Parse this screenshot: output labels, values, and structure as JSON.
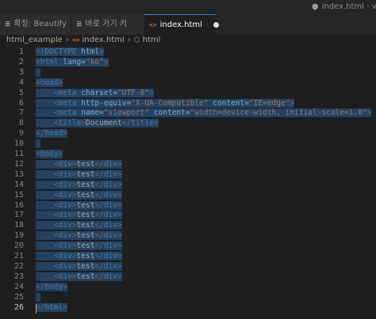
{
  "window": {
    "title": "index.html - vs"
  },
  "tabs": [
    {
      "label": "확장: Beautify",
      "icon": "extension-list-icon",
      "active": false
    },
    {
      "label": "바로 가기 키",
      "icon": "keyboard-list-icon",
      "active": false
    },
    {
      "label": "index.html",
      "icon": "html-file-icon",
      "active": true,
      "modified": true
    }
  ],
  "breadcrumb": {
    "folder": "html_example",
    "file": "index.html",
    "element": "html"
  },
  "editor": {
    "current_line": 26,
    "lines": [
      {
        "n": "1",
        "indent": 0,
        "parts": [
          [
            "pu",
            "<"
          ],
          [
            "tg",
            "!DOCTYPE"
          ],
          [
            "tx",
            " "
          ],
          [
            "at",
            "html"
          ],
          [
            "pu",
            ">"
          ]
        ]
      },
      {
        "n": "2",
        "indent": 0,
        "parts": [
          [
            "pu",
            "<"
          ],
          [
            "tg",
            "html"
          ],
          [
            "tx",
            " "
          ],
          [
            "at",
            "lang"
          ],
          [
            "tx",
            "="
          ],
          [
            "av",
            "\"ko\""
          ],
          [
            "pu",
            ">"
          ]
        ]
      },
      {
        "n": "3",
        "indent": 0,
        "parts": []
      },
      {
        "n": "4",
        "indent": 0,
        "parts": [
          [
            "pu",
            "<"
          ],
          [
            "tg",
            "head"
          ],
          [
            "pu",
            ">"
          ]
        ]
      },
      {
        "n": "5",
        "indent": 1,
        "parts": [
          [
            "pu",
            "<"
          ],
          [
            "tg",
            "meta"
          ],
          [
            "tx",
            " "
          ],
          [
            "at",
            "charset"
          ],
          [
            "tx",
            "="
          ],
          [
            "av",
            "\"UTF-8\""
          ],
          [
            "pu",
            ">"
          ]
        ]
      },
      {
        "n": "6",
        "indent": 1,
        "parts": [
          [
            "pu",
            "<"
          ],
          [
            "tg",
            "meta"
          ],
          [
            "tx",
            " "
          ],
          [
            "at",
            "http-equiv"
          ],
          [
            "tx",
            "="
          ],
          [
            "av",
            "\"X-UA-Compatible\""
          ],
          [
            "tx",
            " "
          ],
          [
            "at",
            "content"
          ],
          [
            "tx",
            "="
          ],
          [
            "av",
            "\"IE=edge\""
          ],
          [
            "pu",
            ">"
          ]
        ]
      },
      {
        "n": "7",
        "indent": 1,
        "parts": [
          [
            "pu",
            "<"
          ],
          [
            "tg",
            "meta"
          ],
          [
            "tx",
            " "
          ],
          [
            "at",
            "name"
          ],
          [
            "tx",
            "="
          ],
          [
            "av",
            "\"viewport\""
          ],
          [
            "tx",
            " "
          ],
          [
            "at",
            "content"
          ],
          [
            "tx",
            "="
          ],
          [
            "av",
            "\"width=device-width, initial-scale=1.0\""
          ],
          [
            "pu",
            ">"
          ]
        ]
      },
      {
        "n": "8",
        "indent": 1,
        "parts": [
          [
            "pu",
            "<"
          ],
          [
            "tg",
            "title"
          ],
          [
            "pu",
            ">"
          ],
          [
            "tx",
            "Document"
          ],
          [
            "pu",
            "</"
          ],
          [
            "tg",
            "title"
          ],
          [
            "pu",
            ">"
          ]
        ]
      },
      {
        "n": "9",
        "indent": 0,
        "parts": [
          [
            "pu",
            "</"
          ],
          [
            "tg",
            "head"
          ],
          [
            "pu",
            ">"
          ]
        ]
      },
      {
        "n": "10",
        "indent": 0,
        "parts": []
      },
      {
        "n": "11",
        "indent": 0,
        "parts": [
          [
            "pu",
            "<"
          ],
          [
            "tg",
            "body"
          ],
          [
            "pu",
            ">"
          ]
        ]
      },
      {
        "n": "12",
        "indent": 1,
        "parts": [
          [
            "pu",
            "<"
          ],
          [
            "tg",
            "div"
          ],
          [
            "pu",
            ">"
          ],
          [
            "tx",
            "test"
          ],
          [
            "pu",
            "</"
          ],
          [
            "tg",
            "div"
          ],
          [
            "pu",
            ">"
          ]
        ]
      },
      {
        "n": "13",
        "indent": 1,
        "parts": [
          [
            "pu",
            "<"
          ],
          [
            "tg",
            "div"
          ],
          [
            "pu",
            ">"
          ],
          [
            "tx",
            "test"
          ],
          [
            "pu",
            "</"
          ],
          [
            "tg",
            "div"
          ],
          [
            "pu",
            ">"
          ]
        ]
      },
      {
        "n": "14",
        "indent": 1,
        "parts": [
          [
            "pu",
            "<"
          ],
          [
            "tg",
            "div"
          ],
          [
            "pu",
            ">"
          ],
          [
            "tx",
            "test"
          ],
          [
            "pu",
            "</"
          ],
          [
            "tg",
            "div"
          ],
          [
            "pu",
            ">"
          ]
        ]
      },
      {
        "n": "15",
        "indent": 1,
        "parts": [
          [
            "pu",
            "<"
          ],
          [
            "tg",
            "div"
          ],
          [
            "pu",
            ">"
          ],
          [
            "tx",
            "test"
          ],
          [
            "pu",
            "</"
          ],
          [
            "tg",
            "div"
          ],
          [
            "pu",
            ">"
          ]
        ]
      },
      {
        "n": "16",
        "indent": 1,
        "parts": [
          [
            "pu",
            "<"
          ],
          [
            "tg",
            "div"
          ],
          [
            "pu",
            ">"
          ],
          [
            "tx",
            "test"
          ],
          [
            "pu",
            "</"
          ],
          [
            "tg",
            "div"
          ],
          [
            "pu",
            ">"
          ]
        ]
      },
      {
        "n": "17",
        "indent": 1,
        "parts": [
          [
            "pu",
            "<"
          ],
          [
            "tg",
            "div"
          ],
          [
            "pu",
            ">"
          ],
          [
            "tx",
            "test"
          ],
          [
            "pu",
            "</"
          ],
          [
            "tg",
            "div"
          ],
          [
            "pu",
            ">"
          ]
        ]
      },
      {
        "n": "18",
        "indent": 1,
        "parts": [
          [
            "pu",
            "<"
          ],
          [
            "tg",
            "div"
          ],
          [
            "pu",
            ">"
          ],
          [
            "tx",
            "test"
          ],
          [
            "pu",
            "</"
          ],
          [
            "tg",
            "div"
          ],
          [
            "pu",
            ">"
          ]
        ]
      },
      {
        "n": "19",
        "indent": 1,
        "parts": [
          [
            "pu",
            "<"
          ],
          [
            "tg",
            "div"
          ],
          [
            "pu",
            ">"
          ],
          [
            "tx",
            "test"
          ],
          [
            "pu",
            "</"
          ],
          [
            "tg",
            "div"
          ],
          [
            "pu",
            ">"
          ]
        ]
      },
      {
        "n": "20",
        "indent": 1,
        "parts": [
          [
            "pu",
            "<"
          ],
          [
            "tg",
            "div"
          ],
          [
            "pu",
            ">"
          ],
          [
            "tx",
            "test"
          ],
          [
            "pu",
            "</"
          ],
          [
            "tg",
            "div"
          ],
          [
            "pu",
            ">"
          ]
        ]
      },
      {
        "n": "21",
        "indent": 1,
        "parts": [
          [
            "pu",
            "<"
          ],
          [
            "tg",
            "div"
          ],
          [
            "pu",
            ">"
          ],
          [
            "tx",
            "test"
          ],
          [
            "pu",
            "</"
          ],
          [
            "tg",
            "div"
          ],
          [
            "pu",
            ">"
          ]
        ]
      },
      {
        "n": "22",
        "indent": 1,
        "parts": [
          [
            "pu",
            "<"
          ],
          [
            "tg",
            "div"
          ],
          [
            "pu",
            ">"
          ],
          [
            "tx",
            "test"
          ],
          [
            "pu",
            "</"
          ],
          [
            "tg",
            "div"
          ],
          [
            "pu",
            ">"
          ]
        ]
      },
      {
        "n": "23",
        "indent": 1,
        "parts": [
          [
            "pu",
            "<"
          ],
          [
            "tg",
            "div"
          ],
          [
            "pu",
            ">"
          ],
          [
            "tx",
            "test"
          ],
          [
            "pu",
            "</"
          ],
          [
            "tg",
            "div"
          ],
          [
            "pu",
            ">"
          ]
        ]
      },
      {
        "n": "24",
        "indent": 0,
        "parts": [
          [
            "pu",
            "</"
          ],
          [
            "tg",
            "body"
          ],
          [
            "pu",
            ">"
          ]
        ]
      },
      {
        "n": "25",
        "indent": 0,
        "parts": []
      },
      {
        "n": "26",
        "indent": 0,
        "parts": [
          [
            "pu",
            "</"
          ],
          [
            "tg",
            "html"
          ],
          [
            "pu",
            ">"
          ]
        ]
      }
    ]
  },
  "colors": {
    "editor_bg": "#1e1e1e",
    "selection": "#264f78",
    "tag": "#569cd6",
    "attribute": "#9cdcfe",
    "string": "#ce9178",
    "active_tab_accent": "#3c79d6"
  }
}
